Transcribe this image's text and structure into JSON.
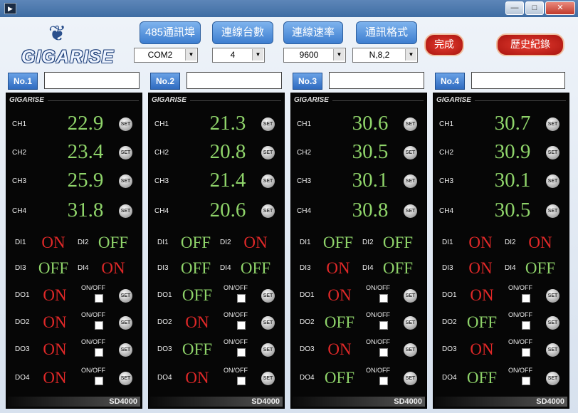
{
  "window": {
    "icon": "play-icon",
    "controls": [
      {
        "name": "minimize-button",
        "icon": "minimize-icon",
        "symbol": "—"
      },
      {
        "name": "maximize-button",
        "icon": "maximize-icon",
        "symbol": "□"
      },
      {
        "name": "close-button",
        "icon": "close-icon",
        "symbol": "✕"
      }
    ]
  },
  "logo": {
    "text": "GIGARISE",
    "icon": "eagle-icon"
  },
  "config": [
    {
      "label": "485通訊埠",
      "value": "COM2"
    },
    {
      "label": "連線台數",
      "value": "4"
    },
    {
      "label": "連線速率",
      "value": "9600"
    },
    {
      "label": "通訊格式",
      "value": "N,8,2"
    }
  ],
  "done_label": "完成",
  "history_label": "歷史紀錄",
  "devices": [
    {
      "label": "No.1",
      "brand": "GIGARISE",
      "model": "SD4000",
      "channels": [
        {
          "name": "CH1",
          "value": "22.9"
        },
        {
          "name": "CH2",
          "value": "23.4"
        },
        {
          "name": "CH3",
          "value": "25.9"
        },
        {
          "name": "CH4",
          "value": "31.8"
        }
      ],
      "di": [
        {
          "name": "DI1",
          "state": "ON"
        },
        {
          "name": "DI2",
          "state": "OFF"
        },
        {
          "name": "DI3",
          "state": "OFF"
        },
        {
          "name": "DI4",
          "state": "ON"
        }
      ],
      "do": [
        {
          "name": "DO1",
          "state": "ON"
        },
        {
          "name": "DO2",
          "state": "ON"
        },
        {
          "name": "DO3",
          "state": "ON"
        },
        {
          "name": "DO4",
          "state": "ON"
        }
      ]
    },
    {
      "label": "No.2",
      "brand": "GIGARISE",
      "model": "SD4000",
      "channels": [
        {
          "name": "CH1",
          "value": "21.3"
        },
        {
          "name": "CH2",
          "value": "20.8"
        },
        {
          "name": "CH3",
          "value": "21.4"
        },
        {
          "name": "CH4",
          "value": "20.6"
        }
      ],
      "di": [
        {
          "name": "DI1",
          "state": "OFF"
        },
        {
          "name": "DI2",
          "state": "ON"
        },
        {
          "name": "DI3",
          "state": "OFF"
        },
        {
          "name": "DI4",
          "state": "OFF"
        }
      ],
      "do": [
        {
          "name": "DO1",
          "state": "OFF"
        },
        {
          "name": "DO2",
          "state": "ON"
        },
        {
          "name": "DO3",
          "state": "OFF"
        },
        {
          "name": "DO4",
          "state": "ON"
        }
      ]
    },
    {
      "label": "No.3",
      "brand": "GIGARISE",
      "model": "SD4000",
      "channels": [
        {
          "name": "CH1",
          "value": "30.6"
        },
        {
          "name": "CH2",
          "value": "30.5"
        },
        {
          "name": "CH3",
          "value": "30.1"
        },
        {
          "name": "CH4",
          "value": "30.8"
        }
      ],
      "di": [
        {
          "name": "DI1",
          "state": "OFF"
        },
        {
          "name": "DI2",
          "state": "OFF"
        },
        {
          "name": "DI3",
          "state": "ON"
        },
        {
          "name": "DI4",
          "state": "OFF"
        }
      ],
      "do": [
        {
          "name": "DO1",
          "state": "ON"
        },
        {
          "name": "DO2",
          "state": "OFF"
        },
        {
          "name": "DO3",
          "state": "ON"
        },
        {
          "name": "DO4",
          "state": "OFF"
        }
      ]
    },
    {
      "label": "No.4",
      "brand": "GIGARISE",
      "model": "SD4000",
      "channels": [
        {
          "name": "CH1",
          "value": "30.7"
        },
        {
          "name": "CH2",
          "value": "30.9"
        },
        {
          "name": "CH3",
          "value": "30.1"
        },
        {
          "name": "CH4",
          "value": "30.5"
        }
      ],
      "di": [
        {
          "name": "DI1",
          "state": "ON"
        },
        {
          "name": "DI2",
          "state": "ON"
        },
        {
          "name": "DI3",
          "state": "ON"
        },
        {
          "name": "DI4",
          "state": "OFF"
        }
      ],
      "do": [
        {
          "name": "DO1",
          "state": "ON"
        },
        {
          "name": "DO2",
          "state": "OFF"
        },
        {
          "name": "DO3",
          "state": "ON"
        },
        {
          "name": "DO4",
          "state": "OFF"
        }
      ]
    }
  ],
  "set_label": "SET",
  "onoff_label": "ON/OFF",
  "colors": {
    "on": "#e02828",
    "off": "#8fd46a",
    "value": "#8fd46a",
    "button": "#3d7ed0",
    "accent_red": "#c0211a"
  }
}
